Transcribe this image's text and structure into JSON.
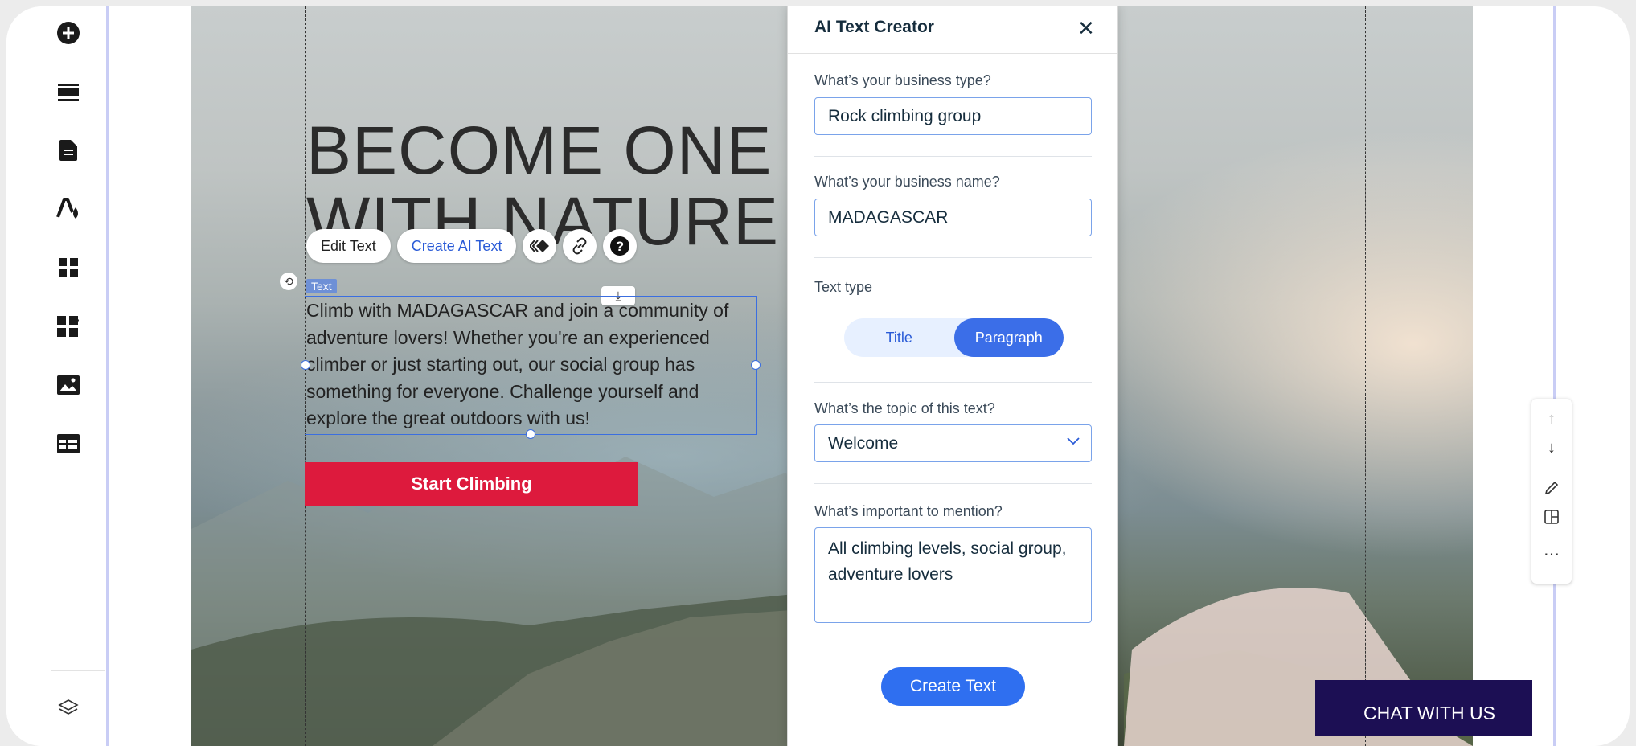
{
  "sidebar": {
    "icons": [
      "add-icon",
      "sections-icon",
      "pages-icon",
      "theme-icon",
      "apps-icon",
      "business-apps-icon",
      "media-icon",
      "cms-icon"
    ],
    "bottom_icon": "layers-icon"
  },
  "hero": {
    "headline_line1": "BECOME ONE",
    "headline_line2": "WITH NATURE",
    "paragraph": "Climb with MADAGASCAR and join a community of adventure lovers! Whether you're an experienced climber or just starting out, our social group has something for everyone. Challenge yourself and explore the great outdoors with us!",
    "cta_label": "Start Climbing"
  },
  "toolbar": {
    "edit_text": "Edit Text",
    "create_ai_text": "Create AI Text",
    "text_tag": "Text"
  },
  "panel": {
    "title": "AI Text Creator",
    "business_type_label": "What’s your business type?",
    "business_type_value": "Rock climbing group",
    "business_name_label": "What’s your business name?",
    "business_name_value": "MADAGASCAR",
    "text_type_label": "Text type",
    "text_type_options": [
      "Title",
      "Paragraph"
    ],
    "text_type_selected": "Paragraph",
    "topic_label": "What’s the topic of this text?",
    "topic_value": "Welcome",
    "mention_label": "What’s important to mention?",
    "mention_value": "All climbing levels, social group, adventure lovers",
    "create_button": "Create Text"
  },
  "chat": {
    "label": "CHAT WITH US"
  },
  "colors": {
    "accent": "#2f6ff0",
    "cta": "#dd1a3d",
    "chat_bg": "#1c0f54"
  }
}
